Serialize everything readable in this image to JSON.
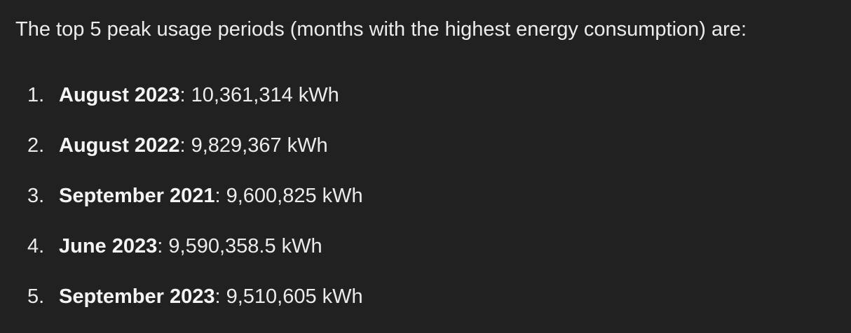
{
  "message": {
    "intro": "The top 5 peak usage periods (months with the highest energy consumption) are:",
    "items": [
      {
        "num": "1.",
        "period": "August 2023",
        "value": " 10,361,314 kWh"
      },
      {
        "num": "2.",
        "period": "August 2022",
        "value": " 9,829,367 kWh"
      },
      {
        "num": "3.",
        "period": "September 2021",
        "value": " 9,600,825 kWh"
      },
      {
        "num": "4.",
        "period": "June 2023",
        "value": " 9,590,358.5 kWh"
      },
      {
        "num": "5.",
        "period": "September 2023",
        "value": " 9,510,605 kWh"
      }
    ]
  },
  "colors": {
    "background": "#212121",
    "text": "#ececec"
  }
}
